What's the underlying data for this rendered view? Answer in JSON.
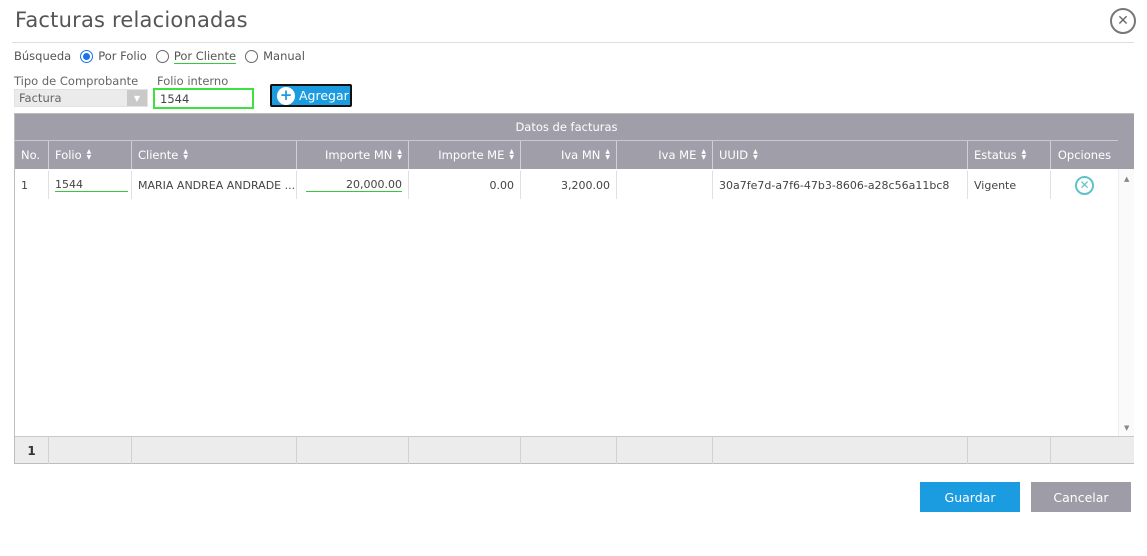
{
  "dialog": {
    "title": "Facturas relacionadas",
    "close_icon": "close-icon"
  },
  "search": {
    "label": "Búsqueda",
    "options": [
      {
        "label": "Por Folio",
        "checked": true
      },
      {
        "label": "Por Cliente",
        "checked": false
      },
      {
        "label": "Manual",
        "checked": false
      }
    ]
  },
  "form": {
    "tipo_label": "Tipo de Comprobante",
    "tipo_value": "Factura",
    "folio_label": "Folio interno",
    "folio_value": "1544",
    "agregar_label": "Agregar"
  },
  "grid": {
    "group_title": "Datos de facturas",
    "columns": [
      "No.",
      "Folio",
      "Cliente",
      "Importe MN",
      "Importe ME",
      "Iva MN",
      "Iva ME",
      "UUID",
      "Estatus",
      "Opciones"
    ],
    "rows": [
      {
        "no": "1",
        "folio": "1544",
        "cliente": "MARIA ANDREA ANDRADE ...",
        "importe_mn": "20,000.00",
        "importe_me": "0.00",
        "iva_mn": "3,200.00",
        "iva_me": "",
        "uuid": "30a7fe7d-a7f6-47b3-8606-a28c56a11bc8",
        "estatus": "Vigente"
      }
    ],
    "footer_count": "1"
  },
  "actions": {
    "guardar": "Guardar",
    "cancelar": "Cancelar"
  },
  "colors": {
    "accent": "#1b9ce0",
    "header_bg": "#a09fa9",
    "highlight": "#3ee23e"
  }
}
